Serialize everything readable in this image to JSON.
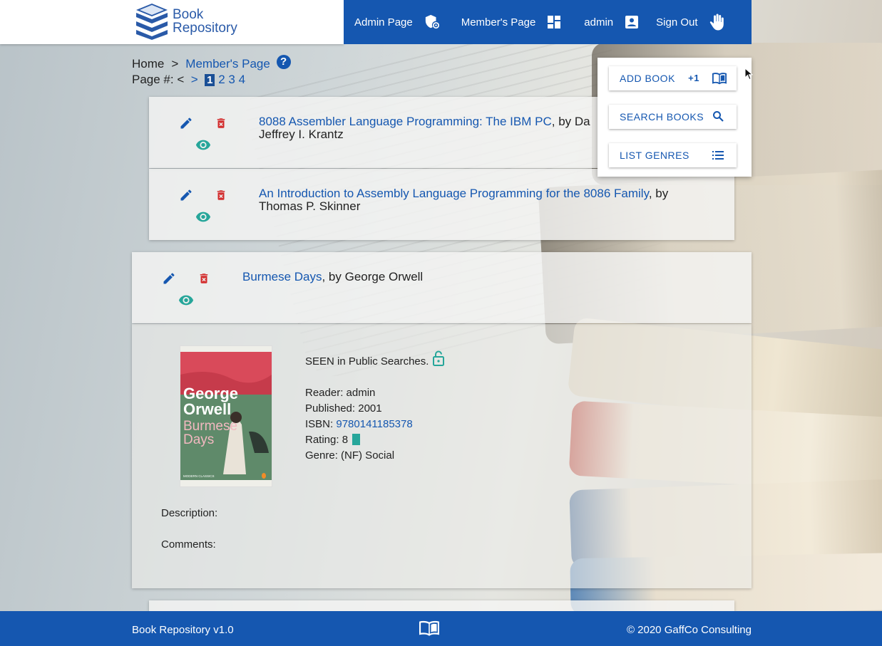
{
  "header": {
    "logo": {
      "line1": "Book",
      "line2": "Repository"
    },
    "nav": [
      {
        "label": "Admin Page",
        "icon": "admin-shield-icon"
      },
      {
        "label": "Member's Page",
        "icon": "dashboard-icon"
      },
      {
        "label": "admin",
        "icon": "account-box-icon"
      },
      {
        "label": "Sign Out",
        "icon": "hand-icon"
      }
    ]
  },
  "breadcrumb": {
    "home": "Home",
    "sep": ">",
    "current": "Member's Page",
    "help": "?"
  },
  "pager": {
    "label": "Page #:",
    "prev": "<",
    "next": ">",
    "current": "1",
    "pages": [
      "2",
      "3",
      "4"
    ]
  },
  "books": [
    {
      "title": "8088 Assembler Language Programming: The IBM PC",
      "by_prefix": ", by Da",
      "author_line2": "Jeffrey I. Krantz"
    },
    {
      "title": "An Introduction to Assembly Language Programming for the 8086 Family",
      "by_prefix": ", by",
      "author_line2": "Thomas P. Skinner"
    },
    {
      "title": "Burmese Days",
      "by_prefix": ", by George Orwell"
    }
  ],
  "menu": {
    "add": {
      "label": "ADD BOOK",
      "badge": "+1"
    },
    "search": {
      "label": "SEARCH BOOKS"
    },
    "genres": {
      "label": "LIST GENRES"
    }
  },
  "detail": {
    "visibility_text": "SEEN in Public Searches.",
    "reader_label": "Reader:",
    "reader": "admin",
    "published_label": "Published:",
    "published": "2001",
    "isbn_label": "ISBN:",
    "isbn": "9780141185378",
    "rating_label": "Rating:",
    "rating": "8",
    "genre_label": "Genre:",
    "genre": "(NF) Social",
    "description_label": "Description:",
    "comments_label": "Comments:",
    "cover": {
      "author_line1": "George",
      "author_line2": "Orwell",
      "title_line1": "Burmese",
      "title_line2": "Days",
      "series": "MODERN CLASSICS"
    }
  },
  "footer": {
    "left": "Book Repository v1.0",
    "right": "© 2020 GaffCo Consulting",
    "icon": "book-open-icon"
  },
  "colors": {
    "brand": "#1557b0",
    "delete": "#d32f2f",
    "view": "#26a69a"
  }
}
